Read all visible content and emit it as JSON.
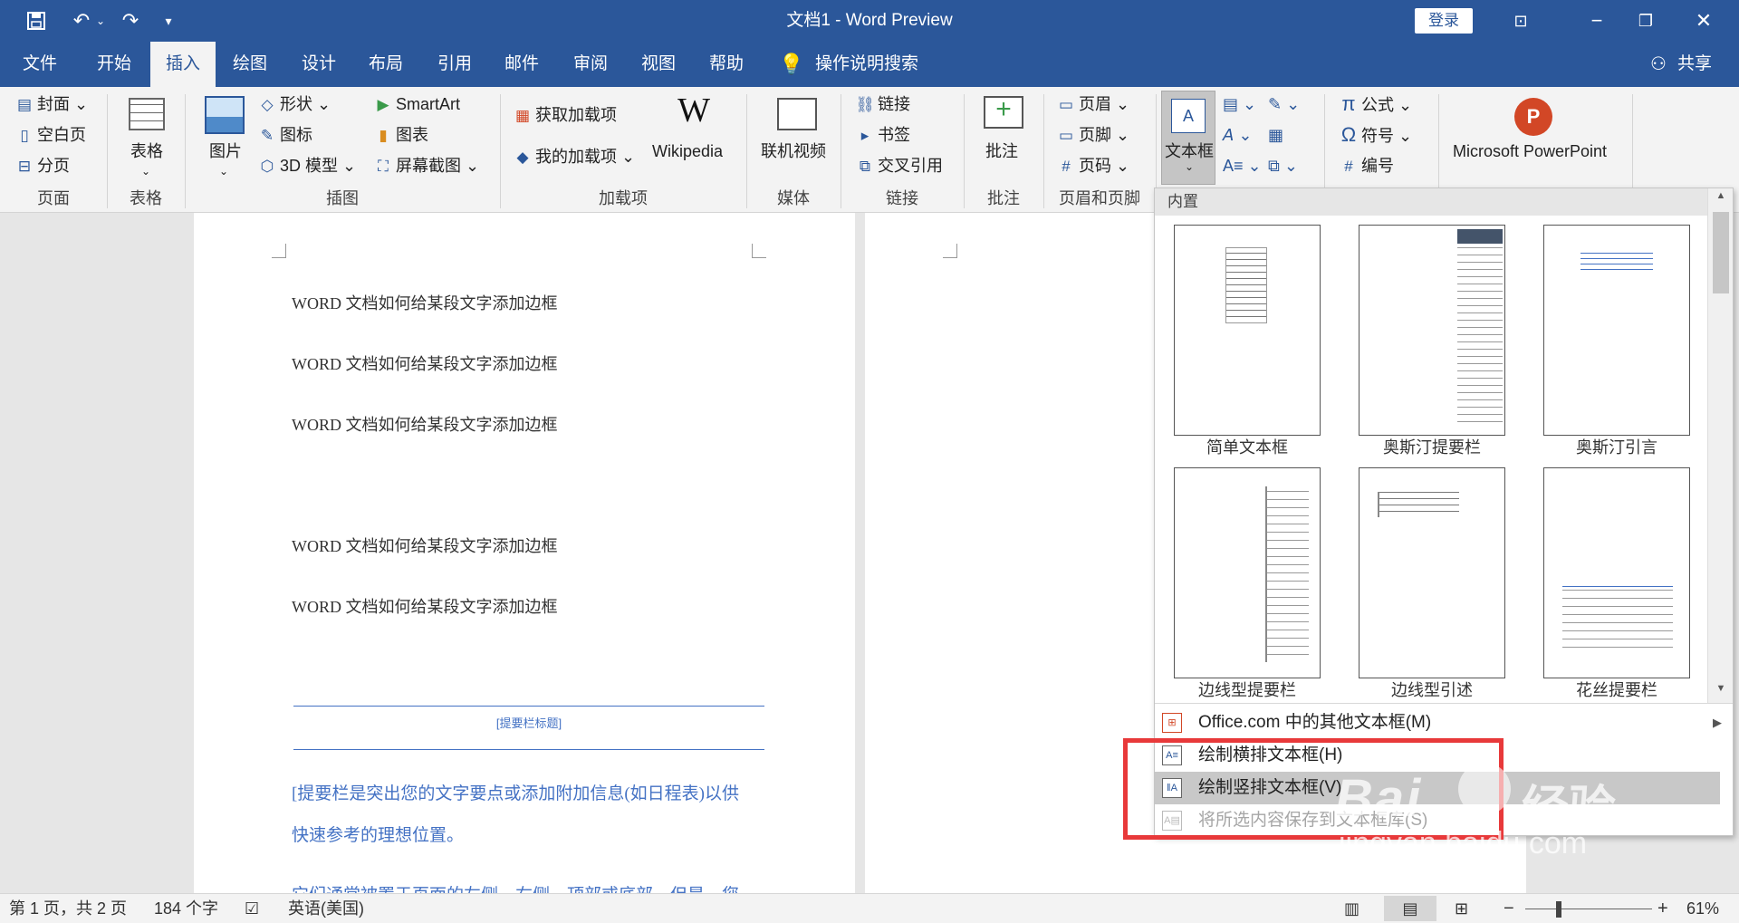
{
  "window": {
    "title": "文档1 - Word Preview",
    "login": "登录"
  },
  "tabs": [
    "文件",
    "开始",
    "插入",
    "绘图",
    "设计",
    "布局",
    "引用",
    "邮件",
    "审阅",
    "视图",
    "帮助"
  ],
  "search": {
    "label": "操作说明搜索"
  },
  "share": "共享",
  "ribbon": {
    "pages": {
      "cover": "封面",
      "blank": "空白页",
      "break": "分页",
      "group": "页面"
    },
    "tables": {
      "table": "表格",
      "group": "表格"
    },
    "illustrations": {
      "picture": "图片",
      "shapes": "形状",
      "icons": "图标",
      "model3d": "3D 模型",
      "smartart": "SmartArt",
      "chart": "图表",
      "screenshot": "屏幕截图",
      "group": "插图"
    },
    "addins": {
      "get": "获取加载项",
      "mine": "我的加载项",
      "wikipedia": "Wikipedia",
      "group": "加载项"
    },
    "media": {
      "video": "联机视频",
      "group": "媒体"
    },
    "links": {
      "link": "链接",
      "bookmark": "书签",
      "crossref": "交叉引用",
      "group": "链接"
    },
    "comments": {
      "comment": "批注",
      "group": "批注"
    },
    "headerfooter": {
      "header": "页眉",
      "footer": "页脚",
      "pagenum": "页码",
      "group": "页眉和页脚"
    },
    "text": {
      "textbox": "文本框"
    },
    "symbols": {
      "equation": "公式",
      "symbol": "符号",
      "number": "编号"
    },
    "powerpoint": "Microsoft PowerPoint"
  },
  "document": {
    "lines": [
      "WORD 文档如何给某段文字添加边框",
      "WORD 文档如何给某段文字添加边框",
      "WORD 文档如何给某段文字添加边框",
      "WORD 文档如何给某段文字添加边框",
      "WORD 文档如何给某段文字添加边框"
    ],
    "sidebar_title": "[提要栏标题]",
    "sidebar_body1": "[提要栏是突出您的文字要点或添加附加信息(如日程表)以供",
    "sidebar_body2": "快速参考的理想位置。",
    "sidebar_body3": "它们通常被置于页面的左侧、右侧、顶部或底部。但是，您"
  },
  "panel": {
    "section": "内置",
    "items": [
      "简单文本框",
      "奥斯汀提要栏",
      "奥斯汀引言",
      "边线型提要栏",
      "边线型引述",
      "花丝提要栏"
    ],
    "menu": [
      "Office.com 中的其他文本框(M)",
      "绘制横排文本框(H)",
      "绘制竖排文本框(V)",
      "将所选内容保存到文本框库(S)"
    ]
  },
  "status": {
    "page": "第 1 页，共 2 页",
    "words": "184 个字",
    "language": "英语(美国)",
    "zoom": "61%"
  },
  "watermark": {
    "brand": "Bai",
    "suffix": "经验",
    "url": "jingyan.baidu.com"
  },
  "colors": {
    "accent": "#2b579a",
    "highlight": "#e8393a",
    "link": "#4472c4"
  }
}
